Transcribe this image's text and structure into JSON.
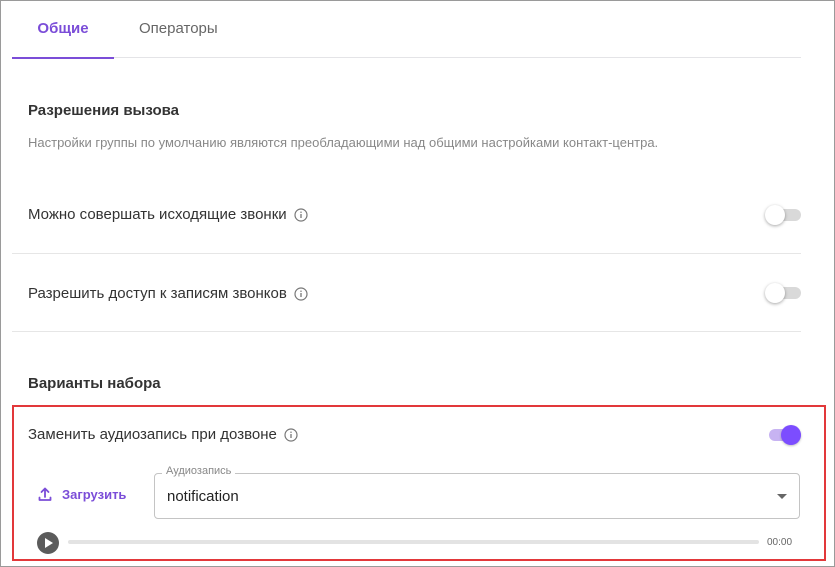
{
  "tabs": [
    {
      "label": "Общие",
      "active": true
    },
    {
      "label": "Операторы",
      "active": false
    }
  ],
  "call_permissions": {
    "title": "Разрешения вызова",
    "subtitle": "Настройки группы по умолчанию являются преобладающими над общими настройками контакт-центра.",
    "outgoing_calls": {
      "label": "Можно совершать исходящие звонки",
      "enabled": false
    },
    "recordings_access": {
      "label": "Разрешить доступ к записям звонков",
      "enabled": false
    }
  },
  "dial_options": {
    "title": "Варианты набора",
    "replace_audio": {
      "label": "Заменить аудиозапись при дозвоне",
      "enabled": true
    },
    "upload_label": "Загрузить",
    "audio_select": {
      "legend": "Аудиозапись",
      "value": "notification"
    },
    "player": {
      "time": "00:00",
      "progress": 0
    }
  },
  "colors": {
    "accent": "#7c4dff",
    "highlight": "#e2383a"
  },
  "icons": [
    "info-icon",
    "upload-icon",
    "chevron-down-icon",
    "play-icon"
  ]
}
